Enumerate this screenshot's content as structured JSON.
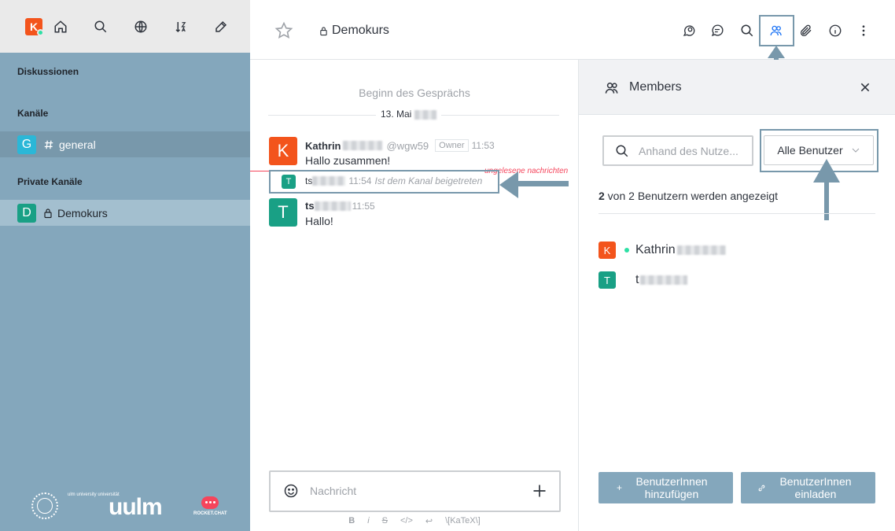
{
  "sidebar": {
    "user_initial": "K",
    "sections": {
      "discussions": "Diskussionen",
      "channels": "Kanäle",
      "private": "Private Kanäle"
    },
    "rooms": [
      {
        "initial": "G",
        "name": "general",
        "color": "#2bb7d7"
      },
      {
        "initial": "D",
        "name": "Demokurs",
        "color": "#19a085"
      }
    ],
    "footer": {
      "uni_small": "ulm university universität",
      "uni_big": "uulm",
      "rc": "ROCKET.CHAT"
    }
  },
  "header": {
    "room_name": "Demokurs"
  },
  "chat": {
    "begin": "Beginn des Gesprächs",
    "date": "13. Mai",
    "unread": "ungelesene nachrichten",
    "messages": [
      {
        "initial": "K",
        "user": "Kathrin",
        "username": "@wgw59",
        "role": "Owner",
        "time": "11:53",
        "text": "Hallo zusammen!",
        "color": "#f3541c"
      },
      {
        "initial": "T",
        "user": "ts",
        "time": "11:54",
        "text": "Ist dem Kanal beigetreten",
        "color": "#19a085"
      },
      {
        "initial": "T",
        "user": "ts",
        "time": "11:55",
        "text": "Hallo!",
        "color": "#19a085"
      }
    ],
    "composer_placeholder": "Nachricht",
    "format": [
      "B",
      "i",
      "S",
      "</>",
      "↩",
      "\\[KaTeX\\]"
    ]
  },
  "panel": {
    "title": "Members",
    "search_placeholder": "Anhand des Nutze...",
    "filter": "Alle Benutzer",
    "count_bold": "2",
    "count_rest": " von 2 Benutzern werden angezeigt",
    "members": [
      {
        "initial": "K",
        "name": "Kathrin",
        "color": "#f3541c",
        "online": true
      },
      {
        "initial": "T",
        "name": "t",
        "color": "#19a085",
        "online": false
      }
    ],
    "add_button": "BenutzerInnen hinzufügen",
    "invite_button": "BenutzerInnen einladen"
  },
  "colors": {
    "sidebar": "#84a7bc",
    "accent": "#1d74f5",
    "highlight": "#7898ab"
  }
}
